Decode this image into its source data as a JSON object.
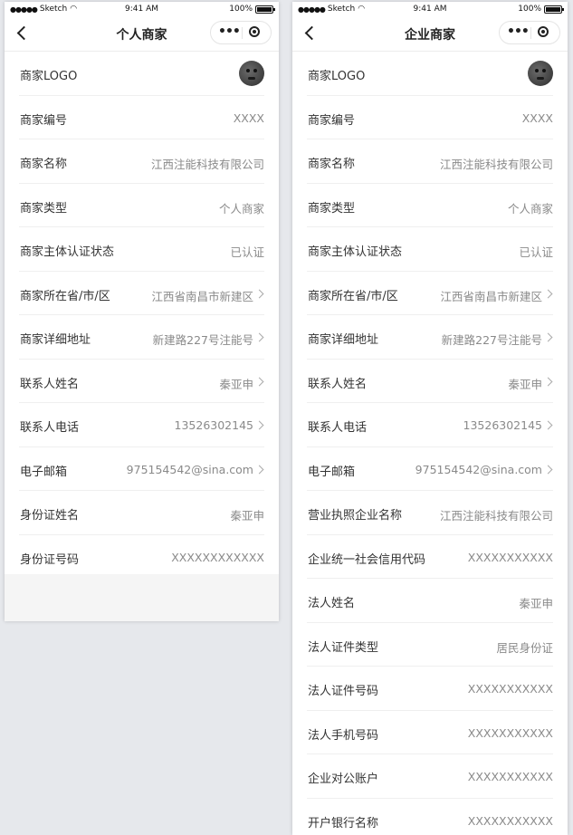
{
  "status": {
    "carrier": "Sketch",
    "time": "9:41 AM",
    "battery": "100%"
  },
  "left": {
    "title": "个人商家",
    "rows": [
      {
        "label": "商家LOGO",
        "value": "",
        "avatar": true,
        "arrow": false
      },
      {
        "label": "商家编号",
        "value": "XXXX",
        "arrow": false
      },
      {
        "label": "商家名称",
        "value": "江西注能科技有限公司",
        "arrow": false
      },
      {
        "label": "商家类型",
        "value": "个人商家",
        "arrow": false
      },
      {
        "label": "商家主体认证状态",
        "value": "已认证",
        "arrow": false
      },
      {
        "label": "商家所在省/市/区",
        "value": "江西省南昌市新建区",
        "arrow": true
      },
      {
        "label": "商家详细地址",
        "value": "新建路227号注能号",
        "arrow": true
      },
      {
        "label": "联系人姓名",
        "value": "秦亚申",
        "arrow": true
      },
      {
        "label": "联系人电话",
        "value": "13526302145",
        "arrow": true
      },
      {
        "label": "电子邮箱",
        "value": "975154542@sina.com",
        "arrow": true
      },
      {
        "label": "身份证姓名",
        "value": "秦亚申",
        "arrow": false
      },
      {
        "label": "身份证号码",
        "value": "XXXXXXXXXXXX",
        "arrow": false
      }
    ]
  },
  "right": {
    "title": "企业商家",
    "rows": [
      {
        "label": "商家LOGO",
        "value": "",
        "avatar": true,
        "arrow": false
      },
      {
        "label": "商家编号",
        "value": "XXXX",
        "arrow": false
      },
      {
        "label": "商家名称",
        "value": "江西注能科技有限公司",
        "arrow": false
      },
      {
        "label": "商家类型",
        "value": "个人商家",
        "arrow": false
      },
      {
        "label": "商家主体认证状态",
        "value": "已认证",
        "arrow": false
      },
      {
        "label": "商家所在省/市/区",
        "value": "江西省南昌市新建区",
        "arrow": true
      },
      {
        "label": "商家详细地址",
        "value": "新建路227号注能号",
        "arrow": true
      },
      {
        "label": "联系人姓名",
        "value": "秦亚申",
        "arrow": true
      },
      {
        "label": "联系人电话",
        "value": "13526302145",
        "arrow": true
      },
      {
        "label": "电子邮箱",
        "value": "975154542@sina.com",
        "arrow": true
      },
      {
        "label": "营业执照企业名称",
        "value": "江西注能科技有限公司",
        "arrow": false
      },
      {
        "label": "企业统一社会信用代码",
        "value": "XXXXXXXXXXX",
        "arrow": false
      },
      {
        "label": "法人姓名",
        "value": "秦亚申",
        "arrow": false
      },
      {
        "label": "法人证件类型",
        "value": "居民身份证",
        "arrow": false
      },
      {
        "label": "法人证件号码",
        "value": "XXXXXXXXXXX",
        "arrow": false
      },
      {
        "label": "法人手机号码",
        "value": "XXXXXXXXXXX",
        "arrow": false
      },
      {
        "label": "企业对公账户",
        "value": "XXXXXXXXXXX",
        "arrow": false
      },
      {
        "label": "开户银行名称",
        "value": "XXXXXXXXXXX",
        "arrow": false
      }
    ]
  }
}
